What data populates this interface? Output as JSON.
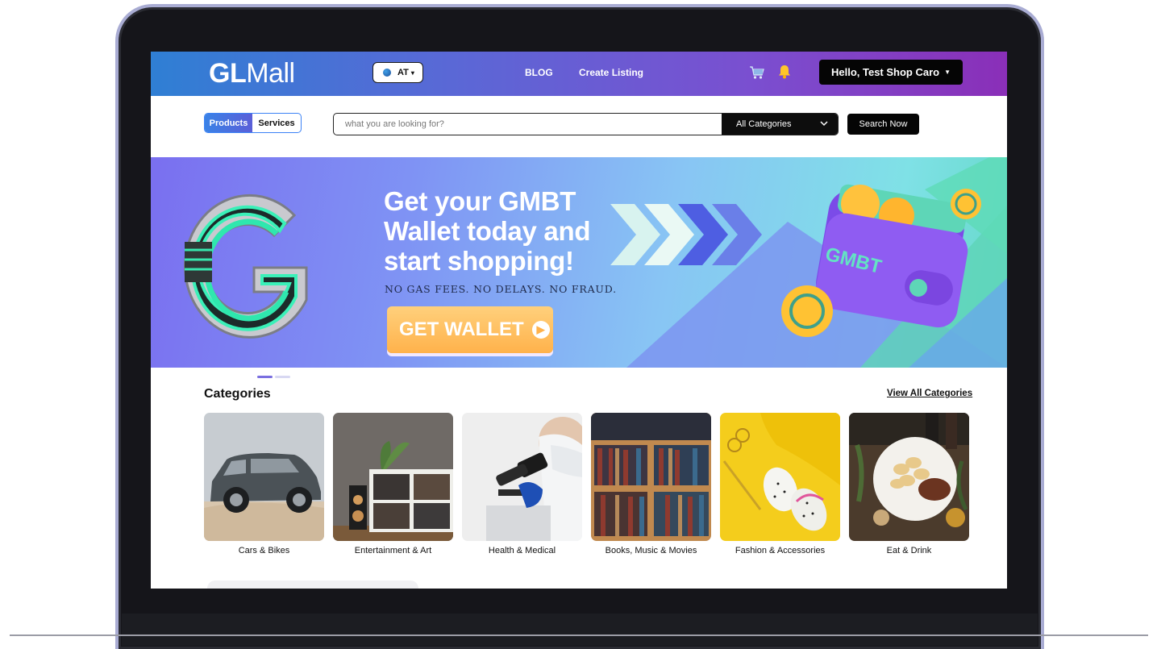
{
  "header": {
    "logo_bold": "GL",
    "logo_regular": "Mall",
    "country_code": "AT",
    "nav": [
      "BLOG",
      "Create Listing"
    ],
    "user_greeting": "Hello, Test Shop Caro",
    "icons": [
      "globe-icon",
      "cart-icon",
      "bell-icon",
      "chevron-down-icon"
    ]
  },
  "search": {
    "toggle": {
      "products": "Products",
      "services": "Services",
      "active": "Products"
    },
    "placeholder": "what you are looking for?",
    "category": "All Categories",
    "button": "Search Now"
  },
  "banner": {
    "title": "Get your GMBT Wallet today and start shopping!",
    "subtitle": "NO GAS FEES. NO DELAYS. NO FRAUD.",
    "cta": "GET WALLET",
    "wallet_text": "GMBT",
    "slide_index": 1,
    "slide_count": 2
  },
  "categories": {
    "heading": "Categories",
    "view_all": "View All Categories",
    "items": [
      {
        "label": "Cars & Bikes"
      },
      {
        "label": "Entertainment & Art"
      },
      {
        "label": "Health & Medical"
      },
      {
        "label": "Books, Music & Movies"
      },
      {
        "label": "Fashion & Accessories"
      },
      {
        "label": "Eat & Drink"
      }
    ]
  },
  "colors": {
    "nav_gradient_start": "#2f7fd4",
    "nav_gradient_end": "#8a2fb8",
    "cta": "#ffb24b",
    "accent": "#3b82f6"
  }
}
